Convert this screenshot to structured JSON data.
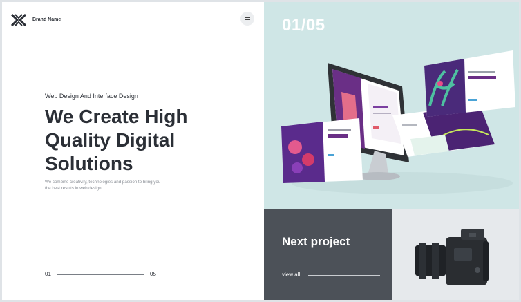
{
  "header": {
    "brand": "Brand Name"
  },
  "hero_text": {
    "kicker": "Web Design And Interface Design",
    "headline": "We Create High Quality Digital Solutions",
    "subtext": "We combine creativity, technologies and passion to bring you the best results in web design."
  },
  "pager": {
    "current": "01",
    "total": "05"
  },
  "slide": {
    "counter": "01/05"
  },
  "next_project": {
    "title": "Next project",
    "view_all": "view all"
  },
  "colors": {
    "hero_bg": "#cfe6e6",
    "dark_panel": "#4c5158",
    "light_panel": "#e6e9ec",
    "text_dark": "#2b2f36"
  }
}
